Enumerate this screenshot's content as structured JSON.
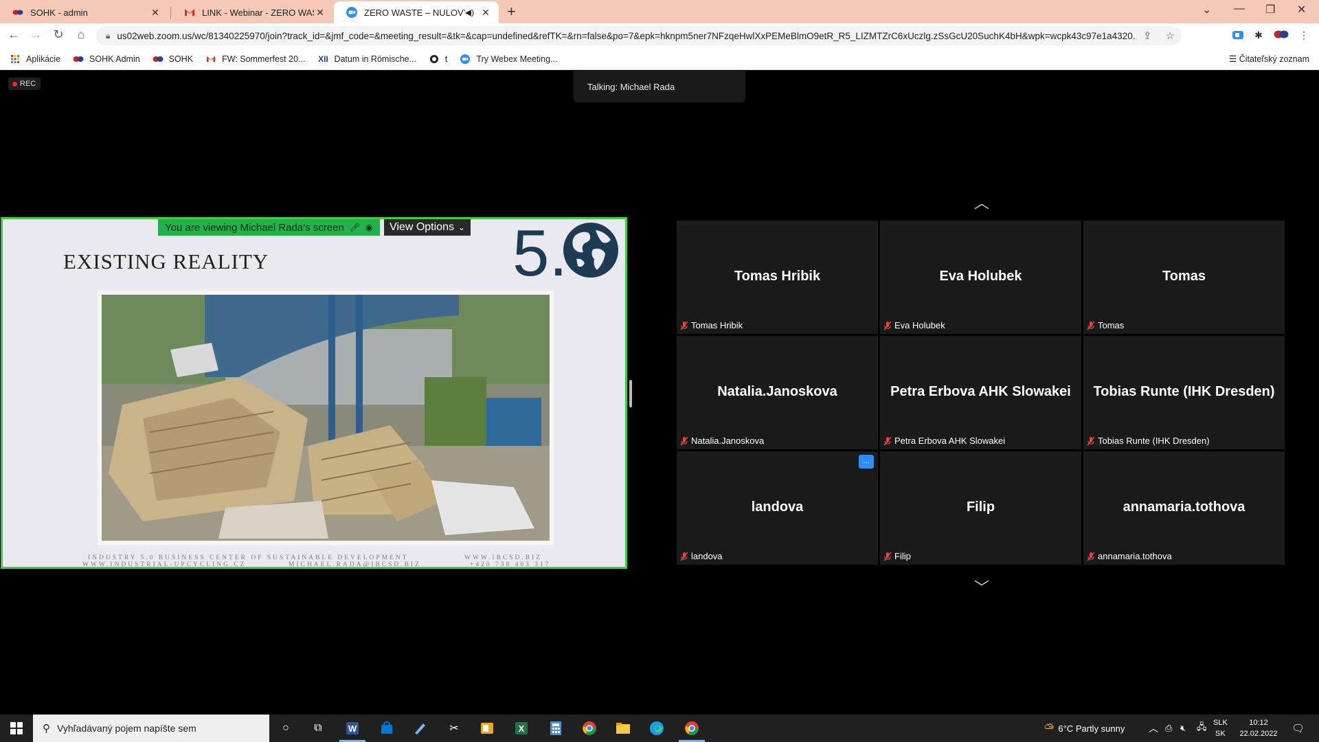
{
  "browser": {
    "tabs": [
      {
        "title": "SOHK - admin",
        "close": "✕"
      },
      {
        "title": "LINK - Webinar - ZERO WASTE -",
        "close": "✕"
      },
      {
        "title": "ZERO WASTE – NULOVÝ OD",
        "close": "✕"
      }
    ],
    "new_tab": "+",
    "url": "us02web.zoom.us/wc/81340225970/join?track_id=&jmf_code=&meeting_result=&tk=&cap=undefined&refTK=&rn=false&po=7&epk=hknpm5ner7NFzqeHwlXxPEMeBlmO9etR_R5_LIZMTZrC6xUczlg.zSsGcU20SuchK4bH&wpk=wcpk43c97e1a4320...",
    "bookmarks": [
      {
        "label": "Aplikácie"
      },
      {
        "label": "SOHK Admin"
      },
      {
        "label": "SOHK"
      },
      {
        "label": "FW: Sommerfest 20..."
      },
      {
        "label": "Datum in Römische..."
      },
      {
        "label": "t"
      },
      {
        "label": "Try Webex Meeting..."
      }
    ],
    "reading_list": "Čitateľský zoznam",
    "accent": "#f6c9b6"
  },
  "zoom": {
    "rec_label": "REC",
    "talking": "Talking: Michael Rada",
    "share_banner": "You are viewing Michael Rada's screen",
    "view_options": "View Options",
    "slide": {
      "title": "EXISTING REALITY",
      "logo_number": "5.",
      "footer_left_top": "INDUSTRY 5.0 BUSINESS CENTER OF SUSTAINABLE DEVELOPMENT",
      "footer_left_bottom": "WWW.INDUSTRIAL-UPCYCLING.CZ",
      "footer_mid_bottom": "MICHAEL.RADA@IBCSD.BIZ",
      "footer_right_top": "WWW.IBCSD.BIZ",
      "footer_right_bottom": "+420 738 403 317"
    },
    "participants": [
      {
        "name": "Tomas Hribik",
        "label": "Tomas Hribik"
      },
      {
        "name": "Eva Holubek",
        "label": "Eva Holubek"
      },
      {
        "name": "Tomas",
        "label": "Tomas"
      },
      {
        "name": "Natalia.Janoskova",
        "label": "Natalia.Janoskova"
      },
      {
        "name": "Petra Erbova AHK Slowakei",
        "label": "Petra Erbova AHK Slowakei"
      },
      {
        "name": "Tobias Runte (IHK Dresden)",
        "label": "Tobias Runte (IHK Dresden)"
      },
      {
        "name": "landova",
        "label": "landova",
        "more": "..."
      },
      {
        "name": "Filip",
        "label": "Filip"
      },
      {
        "name": "annamaria.tothova",
        "label": "annamaria.tothova"
      }
    ],
    "share_border_color": "#3ecf3e"
  },
  "taskbar": {
    "search_placeholder": "Vyhľadávaný pojem napíšte sem",
    "weather": "6°C  Partly sunny",
    "lang_top": "SLK",
    "lang_bottom": "SK",
    "time": "10:12",
    "date": "22.02.2022"
  }
}
